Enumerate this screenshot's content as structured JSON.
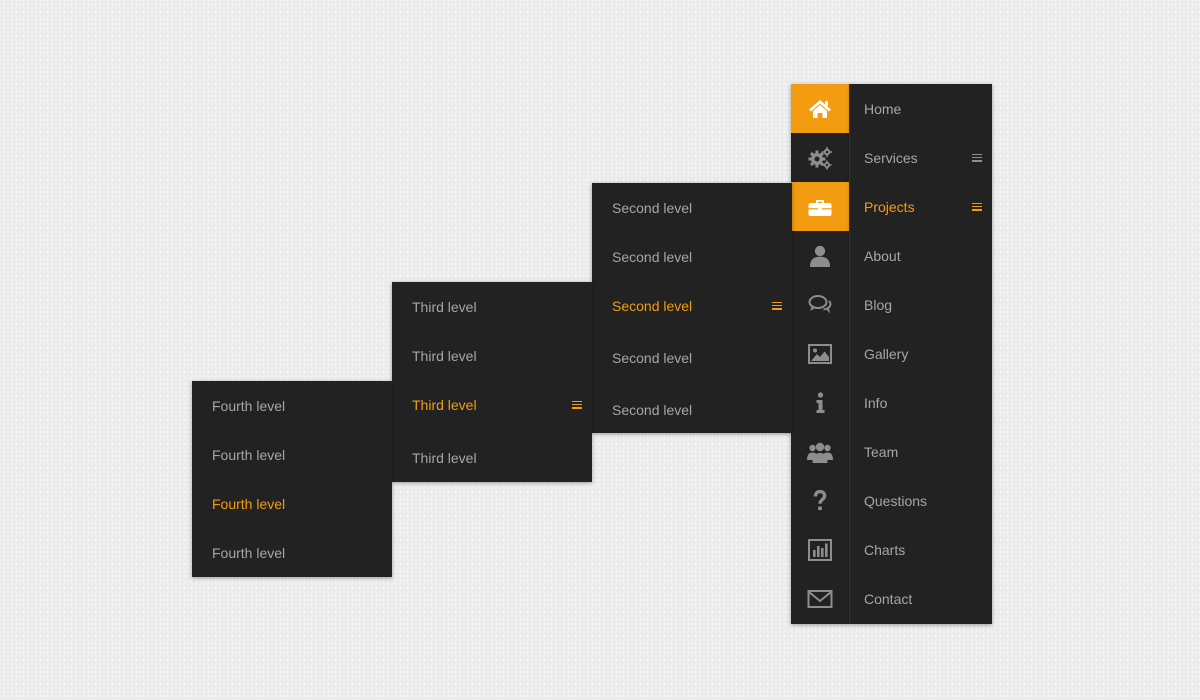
{
  "colors": {
    "accent": "#f39c12",
    "panel": "#222222",
    "text": "#a6a6a6",
    "icon": "#8d8d8d"
  },
  "main_menu": {
    "items": [
      {
        "label": "Home",
        "icon": "home-icon",
        "active_icon": true,
        "has_submenu": false,
        "active": false
      },
      {
        "label": "Services",
        "icon": "gears-icon",
        "active_icon": false,
        "has_submenu": true,
        "active": false
      },
      {
        "label": "Projects",
        "icon": "briefcase-icon",
        "active_icon": true,
        "has_submenu": true,
        "active": true
      },
      {
        "label": "About",
        "icon": "user-icon",
        "active_icon": false,
        "has_submenu": false,
        "active": false
      },
      {
        "label": "Blog",
        "icon": "chat-bubbles-icon",
        "active_icon": false,
        "has_submenu": false,
        "active": false
      },
      {
        "label": "Gallery",
        "icon": "picture-icon",
        "active_icon": false,
        "has_submenu": false,
        "active": false
      },
      {
        "label": "Info",
        "icon": "info-icon",
        "active_icon": false,
        "has_submenu": false,
        "active": false
      },
      {
        "label": "Team",
        "icon": "team-icon",
        "active_icon": false,
        "has_submenu": false,
        "active": false
      },
      {
        "label": "Questions",
        "icon": "question-icon",
        "active_icon": false,
        "has_submenu": false,
        "active": false
      },
      {
        "label": "Charts",
        "icon": "bar-chart-icon",
        "active_icon": false,
        "has_submenu": false,
        "active": false
      },
      {
        "label": "Contact",
        "icon": "envelope-icon",
        "active_icon": false,
        "has_submenu": false,
        "active": false
      }
    ]
  },
  "second_level": {
    "items": [
      {
        "label": "Second level",
        "active": false
      },
      {
        "label": "Second level",
        "active": false
      },
      {
        "label": "Second level",
        "active": true
      },
      {
        "label": "Second level",
        "active": false
      },
      {
        "label": "Second level",
        "active": false
      }
    ]
  },
  "third_level": {
    "items": [
      {
        "label": "Third level",
        "active": false
      },
      {
        "label": "Third level",
        "active": false
      },
      {
        "label": "Third level",
        "active": true
      },
      {
        "label": "Third level",
        "active": false
      }
    ]
  },
  "fourth_level": {
    "items": [
      {
        "label": "Fourth level",
        "active": false
      },
      {
        "label": "Fourth level",
        "active": false
      },
      {
        "label": "Fourth level",
        "active": true
      },
      {
        "label": "Fourth level",
        "active": false
      }
    ]
  }
}
